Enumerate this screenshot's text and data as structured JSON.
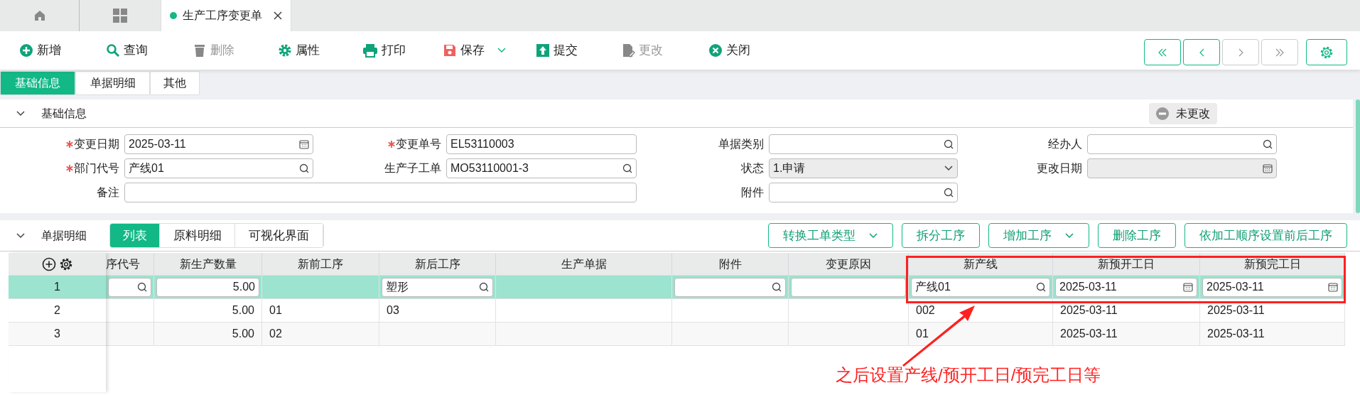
{
  "top_tabs": [
    {
      "kind": "home",
      "selected": false
    },
    {
      "kind": "apps",
      "selected": false
    },
    {
      "kind": "document",
      "label": "生产工序变更单",
      "selected": true
    }
  ],
  "toolbar": [
    {
      "kind": "add",
      "label": "新增",
      "disabled": false
    },
    {
      "kind": "search",
      "label": "查询",
      "disabled": false
    },
    {
      "kind": "delete",
      "label": "删除",
      "disabled": true
    },
    {
      "kind": "properties",
      "label": "属性",
      "disabled": false
    },
    {
      "kind": "print",
      "label": "打印",
      "disabled": false
    },
    {
      "kind": "save",
      "label": "保存",
      "disabled": false,
      "dropdown": true
    },
    {
      "kind": "submit",
      "label": "提交",
      "disabled": false
    },
    {
      "kind": "modify",
      "label": "更改",
      "disabled": true
    },
    {
      "kind": "close",
      "label": "关闭",
      "disabled": false
    }
  ],
  "nav_buttons": [
    {
      "kind": "first",
      "disabled": false
    },
    {
      "kind": "previous",
      "disabled": false
    },
    {
      "kind": "next",
      "disabled": true
    },
    {
      "kind": "last",
      "disabled": true
    }
  ],
  "form_tabs": [
    {
      "label": "基础信息",
      "selected": true
    },
    {
      "label": "单据明细",
      "selected": false
    },
    {
      "label": "其他",
      "selected": false
    }
  ],
  "basic_section": {
    "title": "基础信息",
    "expanded": true,
    "change_state": "未更改",
    "rows": [
      [
        {
          "label": "变更日期",
          "required": true,
          "kind": "date",
          "value": "2025-03-11",
          "disabled": false
        },
        {
          "label": "变更单号",
          "required": true,
          "kind": "text",
          "value": "EL53110003",
          "disabled": false
        },
        {
          "label": "单据类别",
          "required": false,
          "kind": "lookup",
          "disabled": false
        },
        {
          "label": "经办人",
          "required": false,
          "kind": "lookup",
          "disabled": false
        }
      ],
      [
        {
          "label": "部门代号",
          "required": true,
          "kind": "lookup",
          "value": "产线01",
          "disabled": false
        },
        {
          "label": "生产子工单",
          "required": false,
          "kind": "lookup",
          "value": "MO53110001-3",
          "disabled": false
        },
        {
          "label": "状态",
          "required": false,
          "kind": "select",
          "value": "1.申请",
          "disabled": true
        },
        {
          "label": "更改日期",
          "required": false,
          "kind": "date",
          "disabled": true
        }
      ],
      [
        {
          "label": "备注",
          "required": false,
          "kind": "memo",
          "disabled": false
        },
        "",
        {
          "label": "附件",
          "required": false,
          "kind": "lookup",
          "disabled": false
        }
      ]
    ]
  },
  "detail_section": {
    "title": "单据明细",
    "expanded": true,
    "view_tabs": [
      {
        "label": "列表",
        "selected": true
      },
      {
        "label": "原料明细",
        "selected": false
      },
      {
        "label": "可视化界面",
        "selected": false
      }
    ],
    "actions": [
      {
        "label": "转换工单类型",
        "dropdown": true
      },
      {
        "label": "拆分工序",
        "dropdown": false
      },
      {
        "label": "增加工序",
        "dropdown": true
      },
      {
        "label": "删除工序",
        "dropdown": false
      },
      {
        "label": "依加工顺序设置前后工序",
        "dropdown": false
      }
    ]
  },
  "table": {
    "columns": [
      "序代号",
      "新生产数量",
      "新前工序",
      "新后工序",
      "生产单据",
      "附件",
      "变更原因",
      "新产线",
      "新预开工日",
      "新预完工日"
    ],
    "rows": [
      {
        "number": "1",
        "selected": true,
        "cells": [
          {
            "kind": "lookup"
          },
          {
            "kind": "spin",
            "value": "5.00"
          },
          {
            "kind": "blank"
          },
          {
            "kind": "lookup",
            "value": "塑形"
          },
          {
            "kind": "blank"
          },
          {
            "kind": "lookup"
          },
          {
            "kind": "entry"
          },
          {
            "kind": "lookup",
            "value": "产线01"
          },
          {
            "kind": "date",
            "value": "2025-03-11"
          },
          {
            "kind": "date",
            "value": "2025-03-11"
          }
        ]
      },
      {
        "number": "2",
        "selected": false,
        "cells": [
          {
            "kind": "blank"
          },
          {
            "kind": "number",
            "value": "5.00"
          },
          {
            "kind": "text",
            "value": "01"
          },
          {
            "kind": "text",
            "value": "03"
          },
          {
            "kind": "blank"
          },
          {
            "kind": "blank"
          },
          {
            "kind": "blank"
          },
          {
            "kind": "text",
            "value": "002"
          },
          {
            "kind": "text",
            "value": "2025-03-11"
          },
          {
            "kind": "text",
            "value": "2025-03-11"
          }
        ]
      },
      {
        "number": "3",
        "selected": false,
        "cells": [
          {
            "kind": "blank"
          },
          {
            "kind": "number",
            "value": "5.00"
          },
          {
            "kind": "text",
            "value": "02"
          },
          {
            "kind": "blank"
          },
          {
            "kind": "blank"
          },
          {
            "kind": "blank"
          },
          {
            "kind": "blank"
          },
          {
            "kind": "text",
            "value": "01"
          },
          {
            "kind": "text",
            "value": "2025-03-11"
          },
          {
            "kind": "text",
            "value": "2025-03-11"
          }
        ]
      }
    ]
  },
  "annotation": {
    "text": "之后设置产线/预开工日/预完工日等"
  }
}
